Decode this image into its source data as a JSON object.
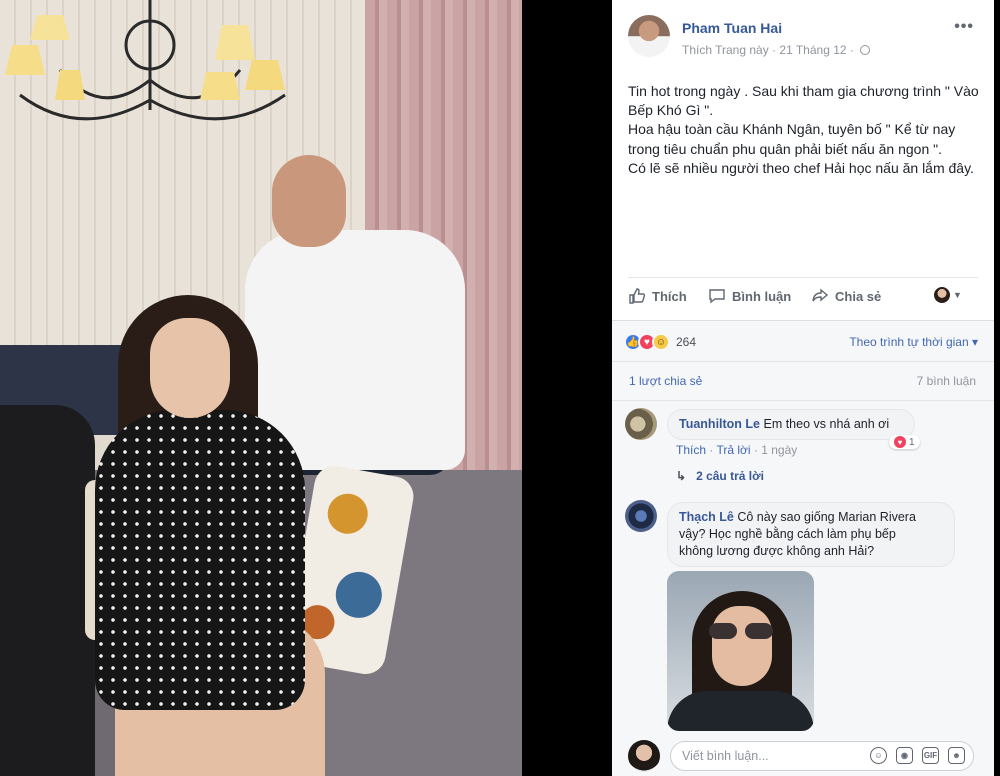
{
  "post": {
    "author": "Pham Tuan Hai",
    "meta_like_page": "Thích Trang này",
    "meta_sep": " · ",
    "meta_date": "21 Tháng 12",
    "meta_sep2": " · ",
    "menu_icon": "more-dots-icon",
    "text_lines": [
      "Tin hot trong ngày . Sau khi tham gia chương trình \" Vào Bếp Khó Gì \".",
      "Hoa hậu toàn cầu Khánh Ngân, tuyên bố \" Kể từ nay trong tiêu chuẩn phu quân phải biết nấu ăn ngon \".",
      "Có lẽ sẽ nhiều người theo chef Hải học nấu ăn lắm đây."
    ]
  },
  "actions": {
    "like": "Thích",
    "comment": "Bình luận",
    "share": "Chia sẻ"
  },
  "reactions": {
    "count": "264",
    "icons": [
      "like-reaction-icon",
      "love-reaction-icon",
      "haha-reaction-icon"
    ]
  },
  "sort_label": "Theo trình tự thời gian ▾",
  "stats": {
    "shares": "1 lượt chia sẻ",
    "comments": "7 bình luận"
  },
  "comments": [
    {
      "name": "Tuanhilton Le",
      "text": " Em theo vs nhá anh ơi",
      "like": "Thích",
      "reply": "Trả lời",
      "time": "1 ngày",
      "reaction_count": "1",
      "replies_label": "2 câu trả lời"
    },
    {
      "name": "Thạch Lê",
      "text_lines": [
        " Cô này sao giống Marian Rivera",
        "vậy? Học nghề bằng cách làm phụ bếp",
        "không lương được không anh Hải?"
      ]
    }
  ],
  "composer": {
    "placeholder": "Viết bình luận...",
    "icons": [
      "emoji-icon",
      "camera-icon",
      "gif-icon",
      "sticker-icon"
    ],
    "gif_label": "GIF"
  },
  "colors": {
    "link_blue": "#365899",
    "accent_blue": "#4267b2",
    "meta_grey": "#90949c",
    "love_red": "#f0415d"
  }
}
